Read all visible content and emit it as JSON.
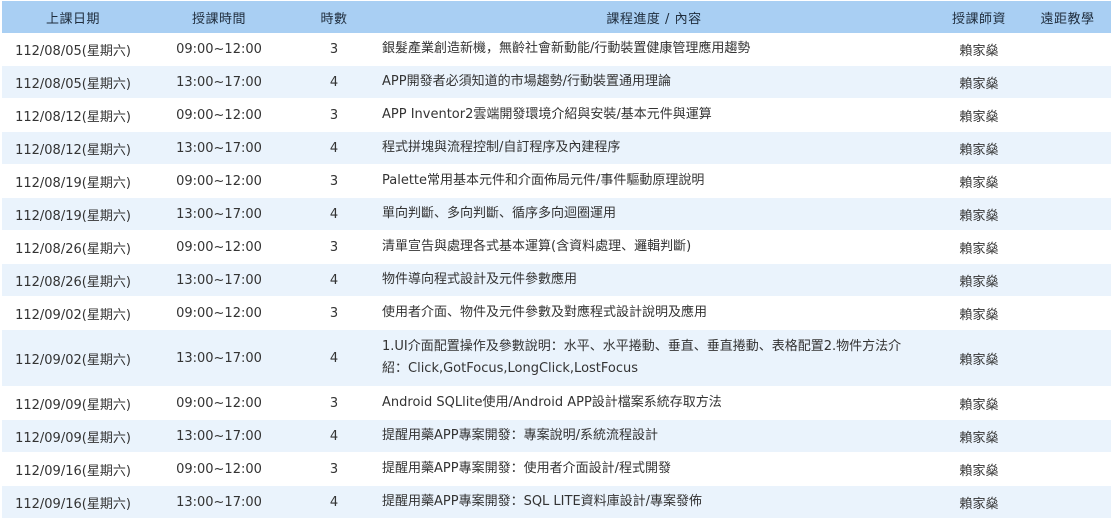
{
  "headers": {
    "date": "上課日期",
    "time": "授課時間",
    "hours": "時數",
    "content": "課程進度 / 內容",
    "teacher": "授課師資",
    "remote": "遠距教學"
  },
  "rows": [
    {
      "date": "112/08/05(星期六)",
      "time": "09:00~12:00",
      "hours": "3",
      "content": "銀髮產業創造新機，無齡社會新動能/行動裝置健康管理應用趨勢",
      "teacher": "賴家燊",
      "remote": ""
    },
    {
      "date": "112/08/05(星期六)",
      "time": "13:00~17:00",
      "hours": "4",
      "content": "APP開發者必須知道的市場趨勢/行動裝置通用理論",
      "teacher": "賴家燊",
      "remote": ""
    },
    {
      "date": "112/08/12(星期六)",
      "time": "09:00~12:00",
      "hours": "3",
      "content": "APP Inventor2雲端開發環境介紹與安裝/基本元件與運算",
      "teacher": "賴家燊",
      "remote": ""
    },
    {
      "date": "112/08/12(星期六)",
      "time": "13:00~17:00",
      "hours": "4",
      "content": "程式拼塊與流程控制/自訂程序及內建程序",
      "teacher": "賴家燊",
      "remote": ""
    },
    {
      "date": "112/08/19(星期六)",
      "time": "09:00~12:00",
      "hours": "3",
      "content": "Palette常用基本元件和介面佈局元件/事件驅動原理說明",
      "teacher": "賴家燊",
      "remote": ""
    },
    {
      "date": "112/08/19(星期六)",
      "time": "13:00~17:00",
      "hours": "4",
      "content": "單向判斷、多向判斷、循序多向迴圈運用",
      "teacher": "賴家燊",
      "remote": ""
    },
    {
      "date": "112/08/26(星期六)",
      "time": "09:00~12:00",
      "hours": "3",
      "content": "清單宣告與處理各式基本運算(含資料處理、邏輯判斷)",
      "teacher": "賴家燊",
      "remote": ""
    },
    {
      "date": "112/08/26(星期六)",
      "time": "13:00~17:00",
      "hours": "4",
      "content": "物件導向程式設計及元件參數應用",
      "teacher": "賴家燊",
      "remote": ""
    },
    {
      "date": "112/09/02(星期六)",
      "time": "09:00~12:00",
      "hours": "3",
      "content": "使用者介面、物件及元件參數及對應程式設計說明及應用",
      "teacher": "賴家燊",
      "remote": ""
    },
    {
      "date": "112/09/02(星期六)",
      "time": "13:00~17:00",
      "hours": "4",
      "content": "1.UI介面配置操作及參數說明：水平、水平捲動、垂直、垂直捲動、表格配置2.物件方法介紹：Click,GotFocus,LongClick,LostFocus",
      "teacher": "賴家燊",
      "remote": ""
    },
    {
      "date": "112/09/09(星期六)",
      "time": "09:00~12:00",
      "hours": "3",
      "content": "Android SQLlite使用/Android APP設計檔案系統存取方法",
      "teacher": "賴家燊",
      "remote": ""
    },
    {
      "date": "112/09/09(星期六)",
      "time": "13:00~17:00",
      "hours": "4",
      "content": "提醒用藥APP專案開發：專案說明/系統流程設計",
      "teacher": "賴家燊",
      "remote": ""
    },
    {
      "date": "112/09/16(星期六)",
      "time": "09:00~12:00",
      "hours": "3",
      "content": "提醒用藥APP專案開發：使用者介面設計/程式開發",
      "teacher": "賴家燊",
      "remote": ""
    },
    {
      "date": "112/09/16(星期六)",
      "time": "13:00~17:00",
      "hours": "4",
      "content": "提醒用藥APP專案開發：SQL LITE資料庫設計/專案發佈",
      "teacher": "賴家燊",
      "remote": ""
    }
  ]
}
